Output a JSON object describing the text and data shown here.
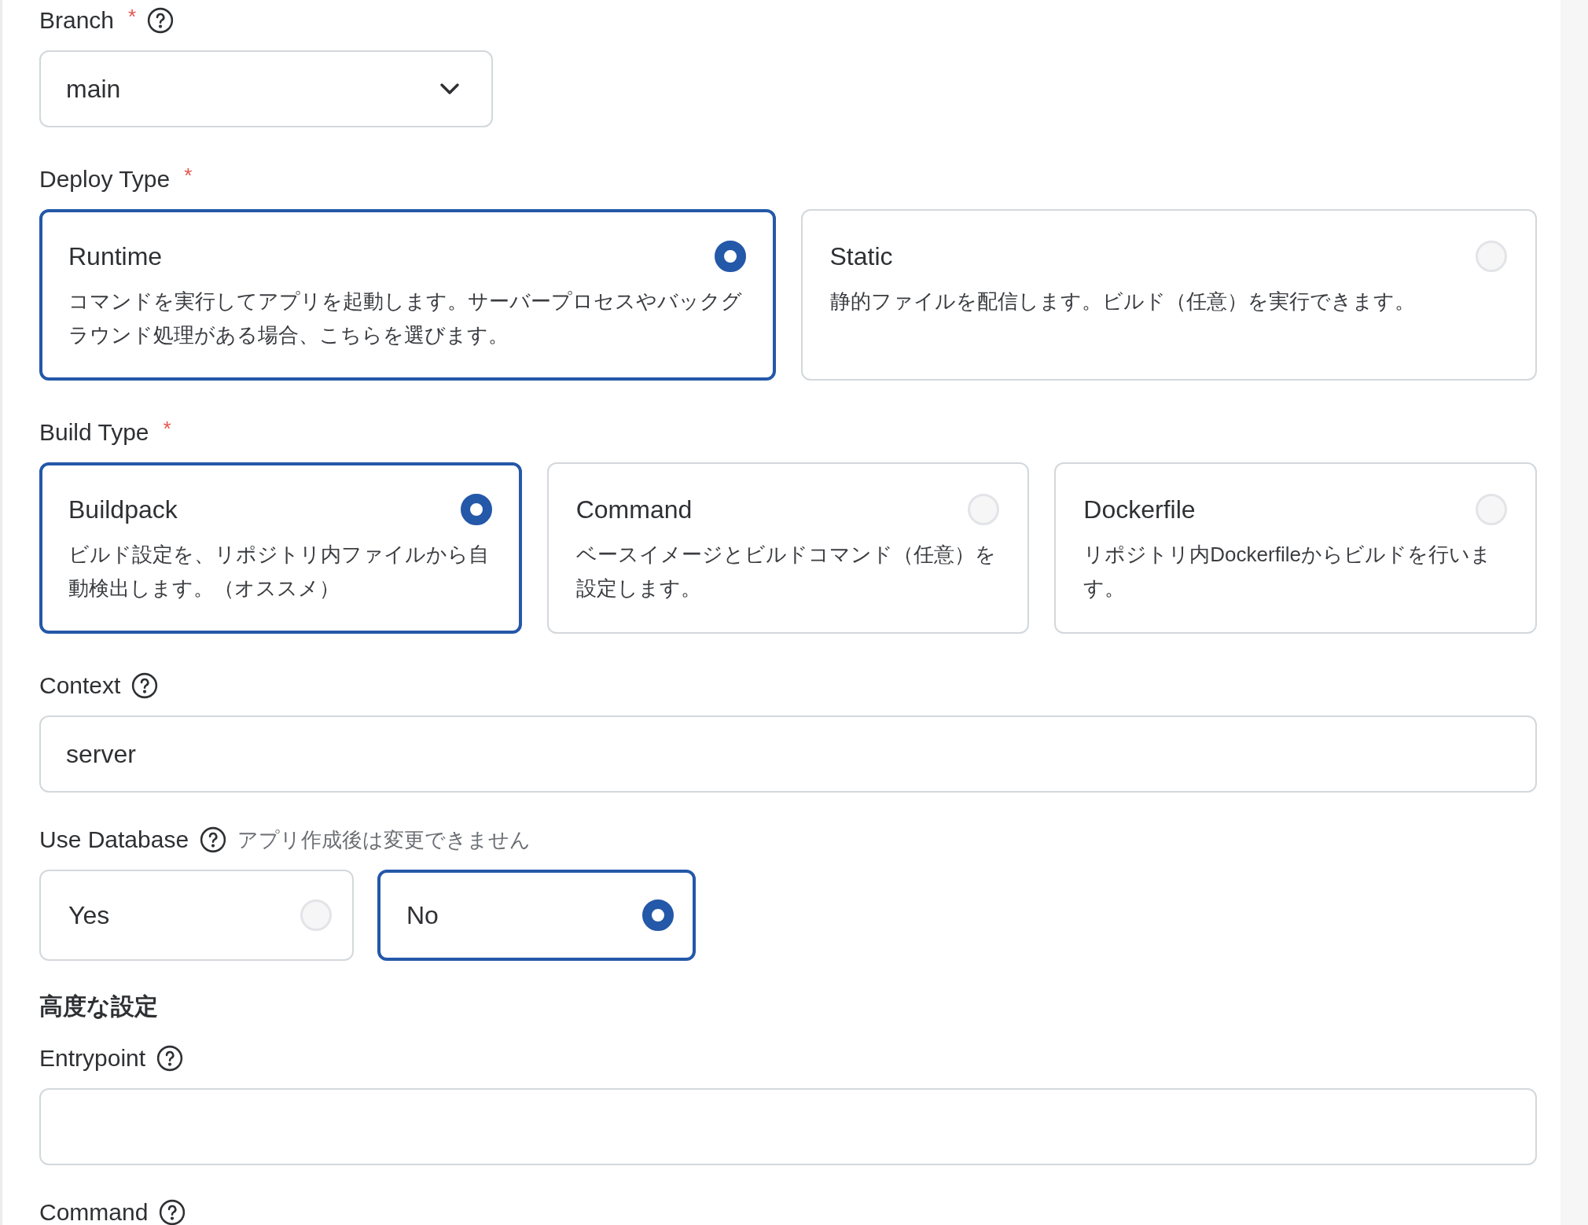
{
  "fields": [
    {
      "kind": "select",
      "label": "Branch",
      "required_mark": "*",
      "help": true,
      "value": "main"
    },
    {
      "kind": "radio_cards",
      "label": "Deploy Type",
      "required_mark": "*",
      "options": [
        {
          "title": "Runtime",
          "description": "コマンドを実行してアプリを起動します。サーバープロセスやバックグラウンド処理がある場合、こちらを選びます。",
          "selected": true
        },
        {
          "title": "Static",
          "description": "静的ファイルを配信します。ビルド（任意）を実行できます。",
          "selected": false
        }
      ]
    },
    {
      "kind": "radio_cards",
      "label": "Build Type",
      "required_mark": "*",
      "options": [
        {
          "title": "Buildpack",
          "description": "ビルド設定を、リポジトリ内ファイルから自動検出します。（オススメ）",
          "selected": true
        },
        {
          "title": "Command",
          "description": "ベースイメージとビルドコマンド（任意）を設定します。",
          "selected": false
        },
        {
          "title": "Dockerfile",
          "description": "リポジトリ内Dockerfileからビルドを行います。",
          "selected": false
        }
      ]
    },
    {
      "kind": "text",
      "label": "Context",
      "help": true,
      "value": "server"
    },
    {
      "kind": "radio_compact",
      "label": "Use Database",
      "help": true,
      "note": "アプリ作成後は変更できません",
      "options": [
        {
          "title": "Yes",
          "selected": false
        },
        {
          "title": "No",
          "selected": true
        }
      ]
    },
    {
      "kind": "heading",
      "label": "高度な設定"
    },
    {
      "kind": "text",
      "label": "Entrypoint",
      "help": true
    },
    {
      "kind": "label_only",
      "label": "Command",
      "help": true
    }
  ]
}
